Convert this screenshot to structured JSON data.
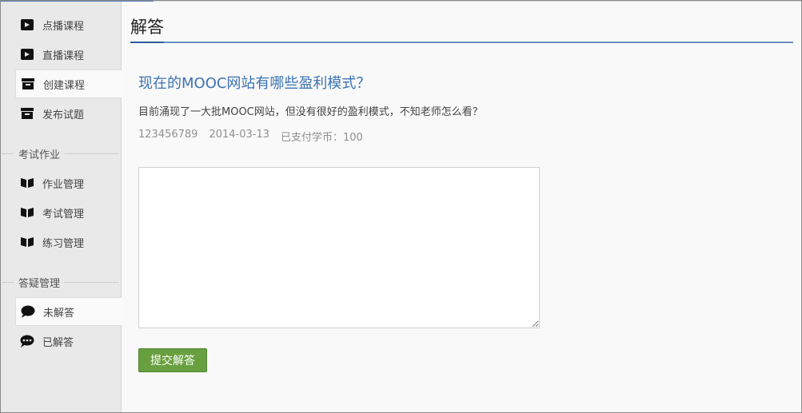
{
  "sidebar": {
    "items": [
      {
        "label": "点播课程",
        "icon": "video-camera-icon",
        "active": false
      },
      {
        "label": "直播课程",
        "icon": "video-camera-icon",
        "active": false
      },
      {
        "label": "创建课程",
        "icon": "archive-box-icon",
        "active": true
      },
      {
        "label": "发布试题",
        "icon": "archive-box-icon",
        "active": false
      }
    ],
    "sections": [
      {
        "label": "考试作业",
        "items": [
          {
            "label": "作业管理",
            "icon": "open-book-icon"
          },
          {
            "label": "考试管理",
            "icon": "open-book-icon"
          },
          {
            "label": "练习管理",
            "icon": "open-book-icon"
          }
        ]
      },
      {
        "label": "答疑管理",
        "items": [
          {
            "label": "未解答",
            "icon": "speech-bubble-icon",
            "active": true
          },
          {
            "label": "已解答",
            "icon": "speech-bubble-dots-icon",
            "active": false
          }
        ]
      }
    ]
  },
  "main": {
    "title": "解答",
    "question": {
      "title": "现在的MOOC网站有哪些盈利模式？",
      "body": "目前涌现了一大批MOOC网站，但没有很好的盈利模式，不知老师怎么看？",
      "user": "123456789",
      "date": "2014-03-13",
      "paid": "已支付学币：100"
    },
    "answer_value": "",
    "submit_label": "提交解答"
  },
  "colors": {
    "accent": "#4e7ab7",
    "link": "#3c73b3",
    "button": "#68a03f",
    "sidebar_bg": "#e9e9e9"
  }
}
